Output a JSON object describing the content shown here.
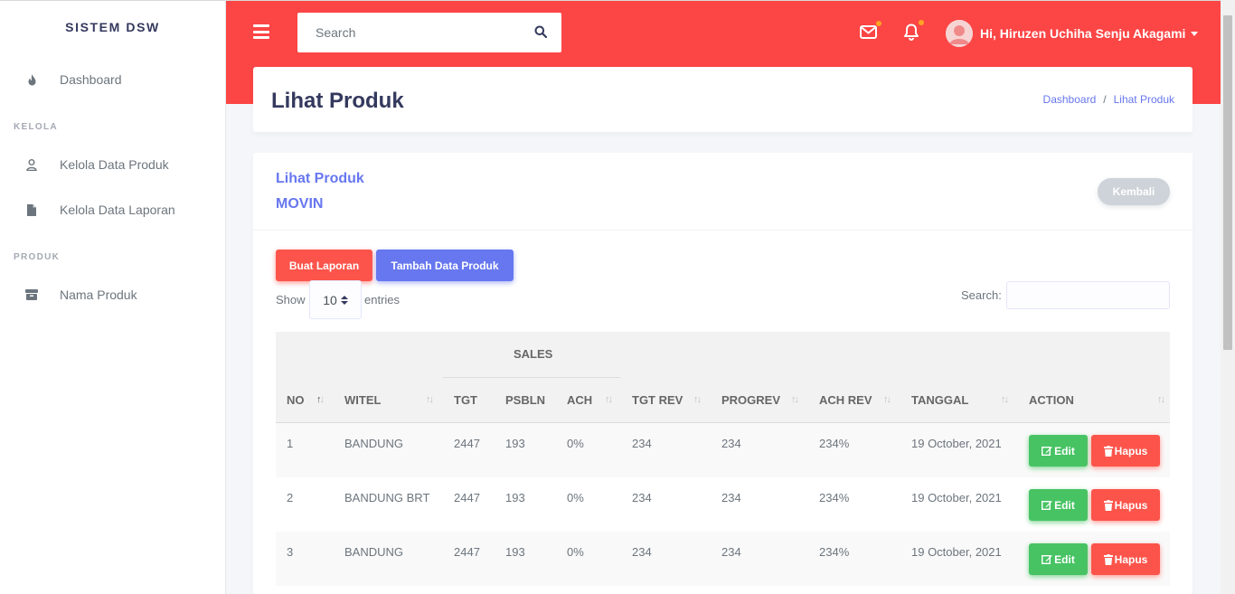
{
  "sidebar": {
    "brand": "SISTEM DSW",
    "dashboard": "Dashboard",
    "section_kelola": "KELOLA",
    "kelola_produk": "Kelola Data Produk",
    "kelola_laporan": "Kelola Data Laporan",
    "section_produk": "PRODUK",
    "nama_produk": "Nama Produk"
  },
  "topbar": {
    "search_placeholder": "Search",
    "user_greeting": "Hi, Hiruzen Uchiha Senju Akagami"
  },
  "section": {
    "title": "Lihat Produk",
    "breadcrumb": [
      "Dashboard",
      "Lihat Produk"
    ]
  },
  "card": {
    "title": "Lihat Produk",
    "subtitle": "MOVIN",
    "back_label": "Kembali",
    "buat_laporan": "Buat Laporan",
    "tambah_data": "Tambah Data Produk",
    "show_label": "Show",
    "entries_value": "10",
    "entries_label": "entries",
    "search_label": "Search:"
  },
  "table": {
    "group_header": "SALES",
    "columns": [
      "NO",
      "WITEL",
      "TGT",
      "PSBLN",
      "ACH",
      "TGT REV",
      "PROGREV",
      "ACH REV",
      "TANGGAL",
      "ACTION"
    ],
    "edit_label": "Edit",
    "hapus_label": "Hapus",
    "rows": [
      [
        "1",
        "BANDUNG",
        "2447",
        "193",
        "0%",
        "234",
        "234",
        "234%",
        "19 October, 2021"
      ],
      [
        "2",
        "BANDUNG BRT",
        "2447",
        "193",
        "0%",
        "234",
        "234",
        "234%",
        "19 October, 2021"
      ],
      [
        "3",
        "BANDUNG",
        "2447",
        "193",
        "0%",
        "234",
        "234",
        "234%",
        "19 October, 2021"
      ]
    ]
  },
  "colors": {
    "primary": "#6777ef",
    "danger": "#fc544b",
    "success": "#47c363",
    "topbar": "#fc4545",
    "notification_dot": "#ffa426"
  },
  "icons": {
    "menu": "hamburger-icon",
    "search": "search-icon",
    "mail": "envelope-icon",
    "bell": "bell-icon",
    "dashboard": "fire-icon",
    "kelola_produk": "user-icon",
    "kelola_laporan": "file-icon",
    "nama_produk": "box-icon"
  }
}
